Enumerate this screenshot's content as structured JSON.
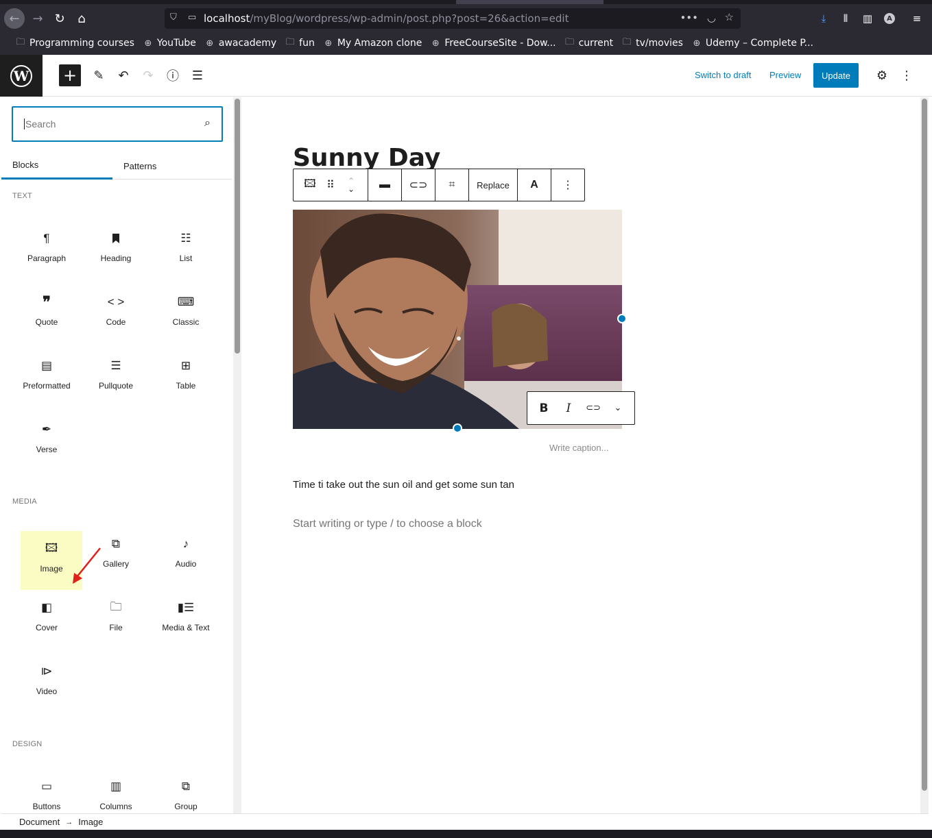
{
  "browser": {
    "url_host": "localhost",
    "url_path": "/myBlog/wordpress/wp-admin/post.php?post=26&action=edit",
    "bookmarks": [
      {
        "label": "Programming courses",
        "icon": "folder-icon"
      },
      {
        "label": "YouTube",
        "icon": "globe-icon"
      },
      {
        "label": "awacademy",
        "icon": "globe-icon"
      },
      {
        "label": "fun",
        "icon": "folder-icon"
      },
      {
        "label": "My Amazon clone",
        "icon": "globe-icon"
      },
      {
        "label": "FreeCourseSite - Dow...",
        "icon": "globe-icon"
      },
      {
        "label": "current",
        "icon": "folder-icon"
      },
      {
        "label": "tv/movies",
        "icon": "folder-icon"
      },
      {
        "label": "Udemy – Complete P...",
        "icon": "globe-icon"
      }
    ],
    "profile_initial": "A"
  },
  "header": {
    "switch_to_draft": "Switch to draft",
    "preview": "Preview",
    "update": "Update",
    "accent": "#007cba"
  },
  "sidebar": {
    "search_placeholder": "Search",
    "tabs": [
      "Blocks",
      "Patterns"
    ],
    "categories": {
      "text": "TEXT",
      "media": "MEDIA",
      "design": "DESIGN"
    },
    "text_blocks": [
      {
        "label": "Paragraph",
        "icon": "paragraph-icon"
      },
      {
        "label": "Heading",
        "icon": "heading-icon"
      },
      {
        "label": "List",
        "icon": "list-icon"
      },
      {
        "label": "Quote",
        "icon": "quote-icon"
      },
      {
        "label": "Code",
        "icon": "code-icon"
      },
      {
        "label": "Classic",
        "icon": "keyboard-icon"
      },
      {
        "label": "Preformatted",
        "icon": "preformatted-icon"
      },
      {
        "label": "Pullquote",
        "icon": "pullquote-icon"
      },
      {
        "label": "Table",
        "icon": "table-icon"
      },
      {
        "label": "Verse",
        "icon": "verse-icon"
      }
    ],
    "media_blocks": [
      {
        "label": "Image",
        "icon": "image-icon"
      },
      {
        "label": "Gallery",
        "icon": "gallery-icon"
      },
      {
        "label": "Audio",
        "icon": "audio-icon"
      },
      {
        "label": "Cover",
        "icon": "cover-icon"
      },
      {
        "label": "File",
        "icon": "file-icon"
      },
      {
        "label": "Media & Text",
        "icon": "media-text-icon"
      },
      {
        "label": "Video",
        "icon": "video-icon"
      }
    ],
    "design_blocks": [
      {
        "label": "Buttons",
        "icon": "buttons-icon"
      },
      {
        "label": "Columns",
        "icon": "columns-icon"
      },
      {
        "label": "Group",
        "icon": "group-icon"
      }
    ]
  },
  "editor": {
    "title": "Sunny Day",
    "toolbar_replace": "Replace",
    "toolbar_text_color": "A",
    "caption_placeholder": "Write caption...",
    "paragraph": "Time ti take out the sun oil and get some sun tan",
    "new_block_placeholder": "Start writing or type / to choose a block"
  },
  "footer": {
    "breadcrumb": [
      "Document",
      "Image"
    ]
  }
}
